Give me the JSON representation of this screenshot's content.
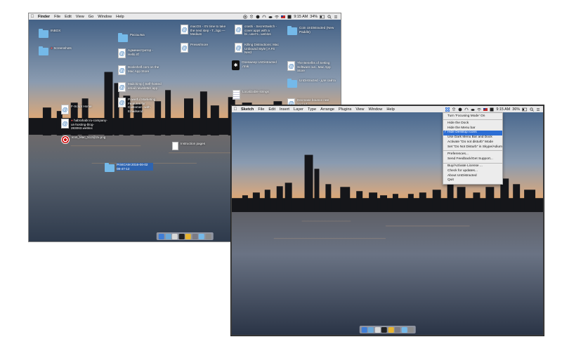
{
  "left_screen": {
    "menubar": {
      "app_name": "Finder",
      "menus": [
        "File",
        "Edit",
        "View",
        "Go",
        "Window",
        "Help"
      ],
      "status": {
        "battery": "34%",
        "time": "9:15 AM"
      }
    },
    "desktop_icons": [
      {
        "label": "INBOX"
      },
      {
        "label": "Screenshots"
      },
      {
        "label": "Рассылка"
      },
      {
        "label": "Администратор - Hello.rtf"
      },
      {
        "label": "Bookshelf.com on the Mac App Store"
      },
      {
        "label": "Mailchimp | Self-hosted email newsletter app"
      },
      {
        "label": "Powerful Marketing Features for Customer...with Emailsend"
      },
      {
        "label": "macOS - It's time to take the next step - T...ligo — Medium"
      },
      {
        "label": "Preset/more"
      },
      {
        "label": "crashi - SecretSwitch - cover apps with a bl...user's...weblos"
      },
      {
        "label": "Killing Distractions: Mac Unbound Style | A Fit Nerd"
      },
      {
        "label": "Onesweep UnDistracted .rtmk"
      },
      {
        "label": "Coin UnDistracted (New Paddle)"
      },
      {
        "label": "The Benefits of Setting Software out...Mac App Store"
      },
      {
        "label": "UnDistracted - для сайта"
      },
      {
        "label": "Localizable strings"
      },
      {
        "label": "Decrease bounce rate and ad blockers...ive..traffic fluorest"
      },
      {
        "label": "F-Script Home"
      },
      {
        "label": "habrahabr.ru-company-us-hosting-blog-283063.webloc"
      },
      {
        "label": "icon_Mac_512@2x.png"
      },
      {
        "label": "Instruction pages"
      },
      {
        "label": "PrintCAM 2016-06-02 08-47-12"
      }
    ]
  },
  "right_screen": {
    "menubar": {
      "app_name": "Sketch",
      "menus": [
        "File",
        "Edit",
        "Insert",
        "Layer",
        "Type",
        "Arrange",
        "Plugins",
        "View",
        "Window",
        "Help"
      ],
      "status": {
        "battery": "36%",
        "time": "9:15 AM"
      }
    },
    "dropdown": {
      "items": [
        {
          "label": "Turn 'Focusing Mode' On"
        },
        {
          "sep": true
        },
        {
          "label": "Hide the Dock"
        },
        {
          "label": "Hide the Menu bar"
        },
        {
          "label": "Hide Desktop Icons",
          "checked": true
        },
        {
          "label": "Use Dark Menu Bar and Dock"
        },
        {
          "label": "Activate \"Do not disturb\" Mode"
        },
        {
          "label": "Set \"Do Not Disturb\" in Skype/Adium"
        },
        {
          "sep": true
        },
        {
          "label": "Preferences..."
        },
        {
          "label": "Send Feedback/Get Support..."
        },
        {
          "sep": true
        },
        {
          "label": "Buy/Activate License ..."
        },
        {
          "label": "Check for updates..."
        },
        {
          "label": "About UnDistracted"
        },
        {
          "label": "Quit"
        }
      ],
      "check_mark": "✓"
    }
  },
  "colors": {
    "selection": "#2c6ed5",
    "folder": "#74b9e9"
  }
}
